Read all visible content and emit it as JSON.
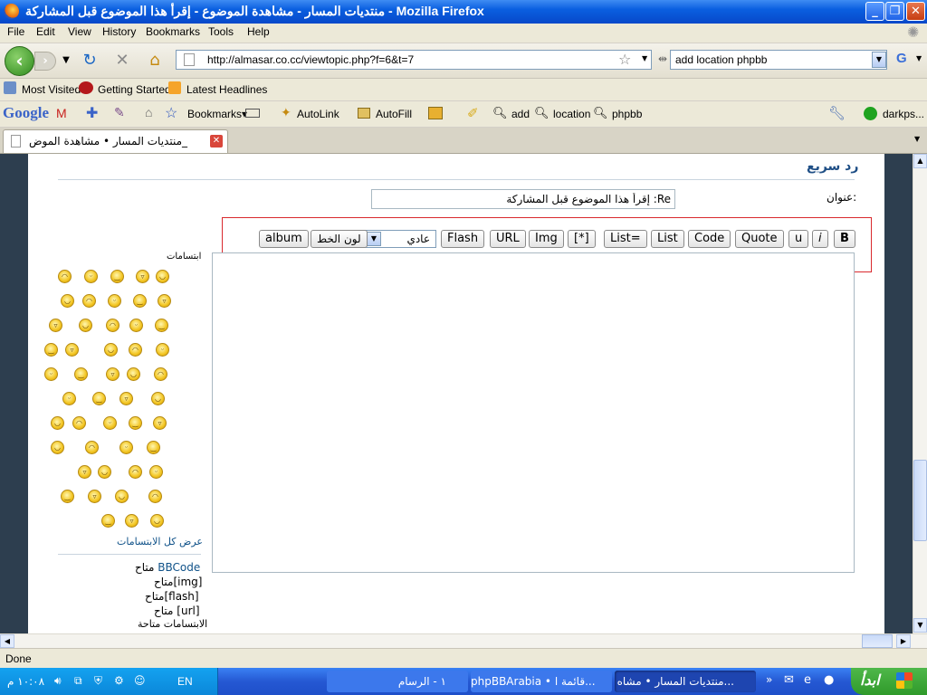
{
  "window": {
    "title": "منتديات المسار - مشاهدة الموضوع - إقرأ هذا الموضوع قبل المشاركة - Mozilla Firefox",
    "minimize": "_",
    "maximize": "❐",
    "close": "✕"
  },
  "menu": [
    "File",
    "Edit",
    "View",
    "History",
    "Bookmarks",
    "Tools",
    "Help"
  ],
  "nav": {
    "url": "http://almasar.co.cc/viewtopic.php?f=6&t=7",
    "search_value": "add location phpbb"
  },
  "bookmarks": [
    "Most Visited",
    "Getting Started",
    "Latest Headlines"
  ],
  "google_bar": {
    "logo": "Google",
    "bookmarks": "Bookmarks▾",
    "autolink": "AutoLink",
    "autofill": "AutoFill",
    "terms": [
      "add",
      "location",
      "phpbb"
    ],
    "user": "darkps..."
  },
  "tab": {
    "label": "منتديات المسار • مشاهدة الموض_"
  },
  "page": {
    "heading": "رد سريع",
    "subject_label": "عنوان:",
    "subject_value": "Re: إقرأ هذا الموضوع قبل المشاركة",
    "bbcode_buttons": [
      "B",
      "i",
      "u",
      "Quote",
      "Code",
      "List",
      "List=",
      "[*]",
      "Img",
      "URL",
      "Flash"
    ],
    "font_size_select": "عادي",
    "font_color_button": "لون الخط",
    "album_button": "album",
    "smilies_title": "ابتسامات",
    "view_all_smilies": "عرض كل الابتسامات",
    "status_lines": [
      {
        "link": "BBCode",
        "text": "متاح"
      },
      {
        "link": "[img]",
        "text": "متاح"
      },
      {
        "link": "[flash]",
        "text": "متاح"
      },
      {
        "link": "[url]",
        "text": "متاح"
      },
      {
        "link": "",
        "text": "الابتسامات متاحة"
      }
    ]
  },
  "status": {
    "text": "Done"
  },
  "taskbar": {
    "start": "ابدأ",
    "tasks": [
      "منتديات المسار • مشاه...",
      "phpBBArabia • قائمة ا...",
      "١ - الرسام"
    ],
    "lang": "EN",
    "clock": "١٠:٠٨ م"
  }
}
